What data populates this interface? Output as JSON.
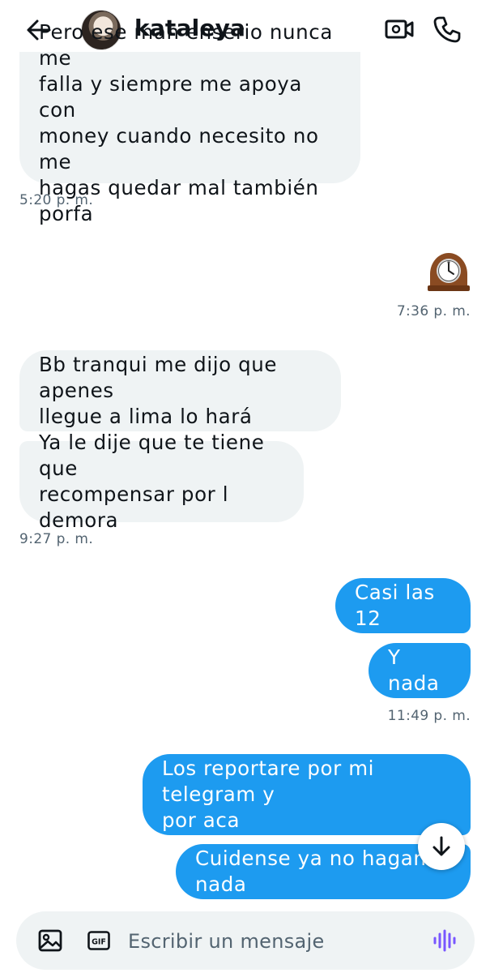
{
  "header": {
    "contact_name": "kataleya"
  },
  "messages": [
    {
      "direction": "received",
      "text": "Pero ese man enserio nunca me falla y siempre me apoya con money cuando necesito no me hagas quedar mal también porfa",
      "lines": [
        "Pero ese man enserio nunca me",
        "falla y siempre me apoya con",
        "money cuando necesito no me",
        "hagas quedar mal también porfa"
      ]
    },
    {
      "time": "5:20 p. m."
    },
    {
      "direction": "sent",
      "emoji": "🕰️"
    },
    {
      "time": "7:36 p. m."
    },
    {
      "direction": "received",
      "lines": [
        "Bb tranqui me dijo que apenes",
        "llegue a lima lo hará"
      ]
    },
    {
      "direction": "received",
      "lines": [
        "Ya le dije que te tiene que",
        "recompensar por l demora"
      ]
    },
    {
      "time": "9:27 p. m."
    },
    {
      "direction": "sent",
      "lines": [
        "Casi las 12"
      ]
    },
    {
      "direction": "sent",
      "lines": [
        "Y nada"
      ]
    },
    {
      "time": "11:49 p. m."
    },
    {
      "direction": "sent",
      "lines": [
        "Los reportare por mi telegram y",
        "por aca"
      ]
    },
    {
      "direction": "sent",
      "lines": [
        "Cuidense ya no hagan nada"
      ]
    }
  ],
  "composer": {
    "placeholder": "Escribir un mensaje",
    "gif_label": "GIF"
  },
  "icons": {
    "back": "arrow-left-icon",
    "video": "video-camera-icon",
    "call": "phone-icon",
    "scroll": "arrow-down-icon",
    "image": "image-icon",
    "gif": "gif-icon",
    "voice": "voice-wave-icon"
  },
  "colors": {
    "sent_bubble": "#1d9bf0",
    "received_bubble": "#eff3f4",
    "voice_accent": "#7856ff",
    "timestamp": "#536471"
  }
}
